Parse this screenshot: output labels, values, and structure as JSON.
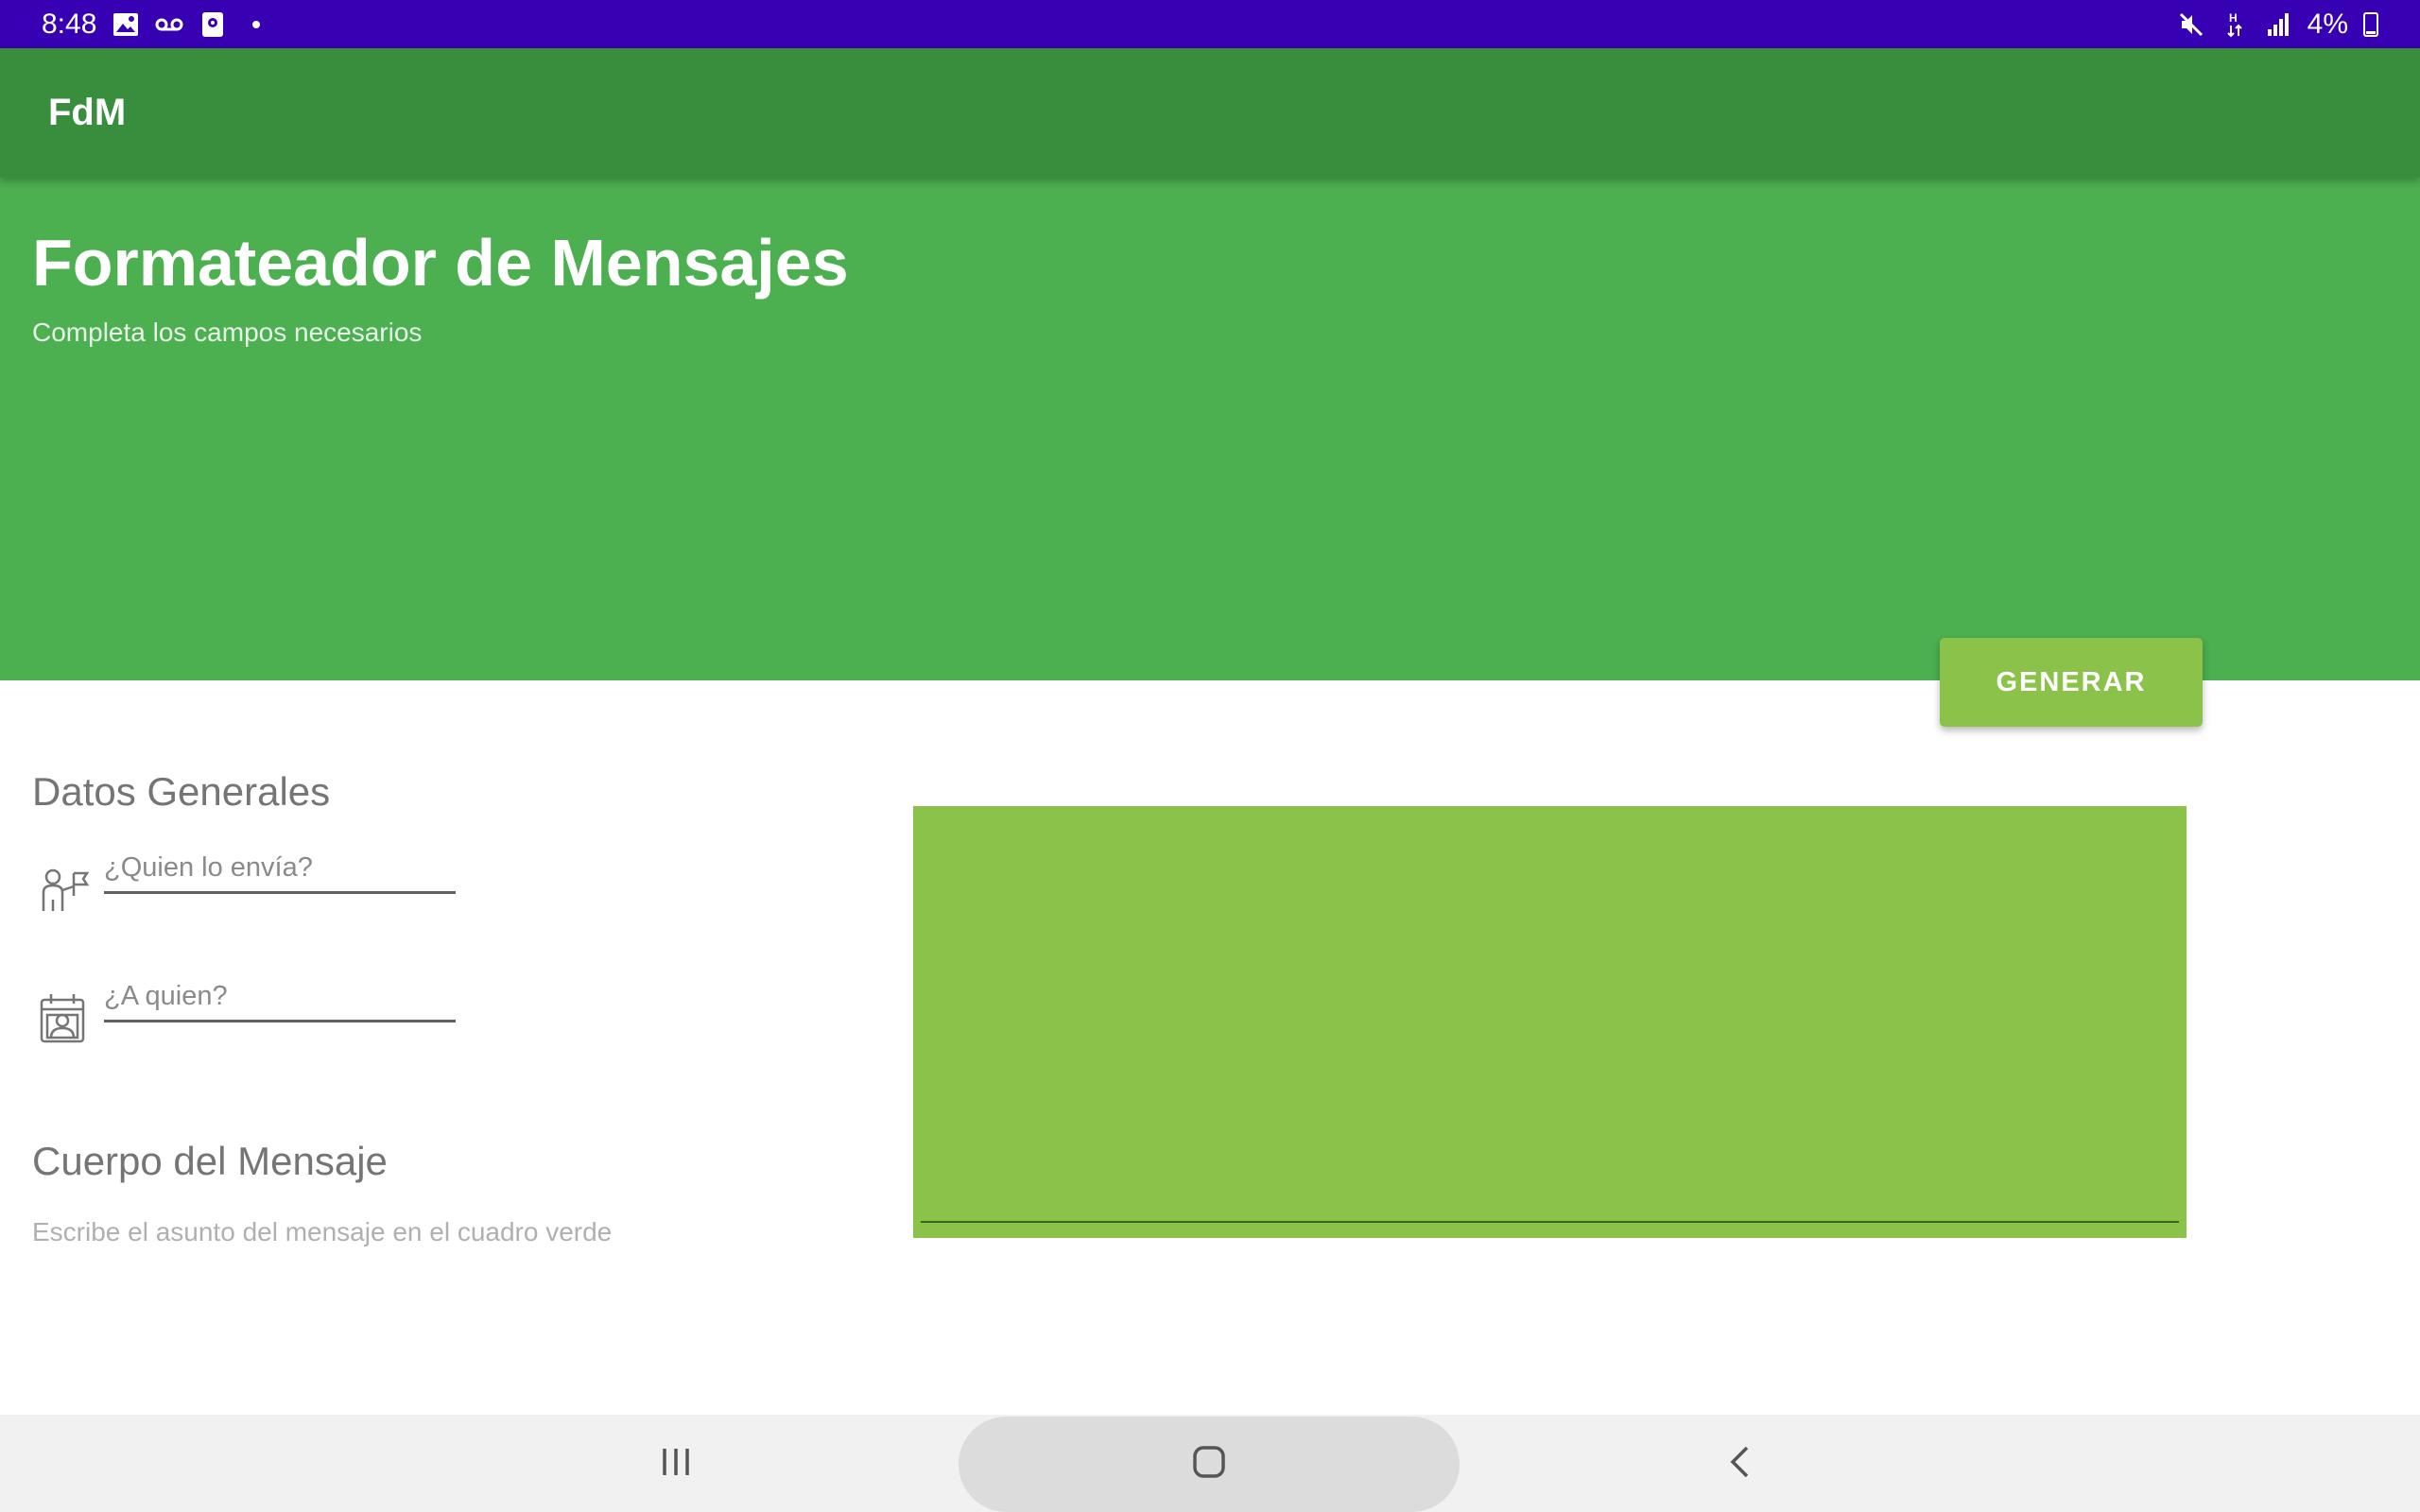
{
  "status_bar": {
    "time": "8:48",
    "battery": "4%",
    "left_icons": [
      "image-icon",
      "voicemail-icon",
      "app-notification-icon",
      "dot-icon"
    ],
    "right_icons": [
      "mute-icon",
      "network-h-icon",
      "signal-icon",
      "battery-icon"
    ],
    "background": "#3700b3"
  },
  "app_bar": {
    "title": "FdM",
    "background": "#388e3c"
  },
  "header": {
    "title": "Formateador de Mensajes",
    "subtitle": "Completa los campos necesarios",
    "background": "#4caf50"
  },
  "generate_button": {
    "label": "GENERAR",
    "background": "#8bc34a"
  },
  "general_section": {
    "heading": "Datos Generales",
    "sender_field": {
      "placeholder": "¿Quien lo envía?",
      "icon": "person-flag-icon"
    },
    "recipient_field": {
      "placeholder": "¿A quien?",
      "icon": "contact-calendar-icon"
    }
  },
  "body_section": {
    "heading": "Cuerpo del Mensaje",
    "hint": "Escribe el asunto del mensaje en el cuadro verde"
  },
  "message_box": {
    "value": "",
    "background": "#8bc34a"
  },
  "nav_bar": {
    "buttons": [
      "recents-icon",
      "home-icon",
      "back-icon"
    ]
  }
}
